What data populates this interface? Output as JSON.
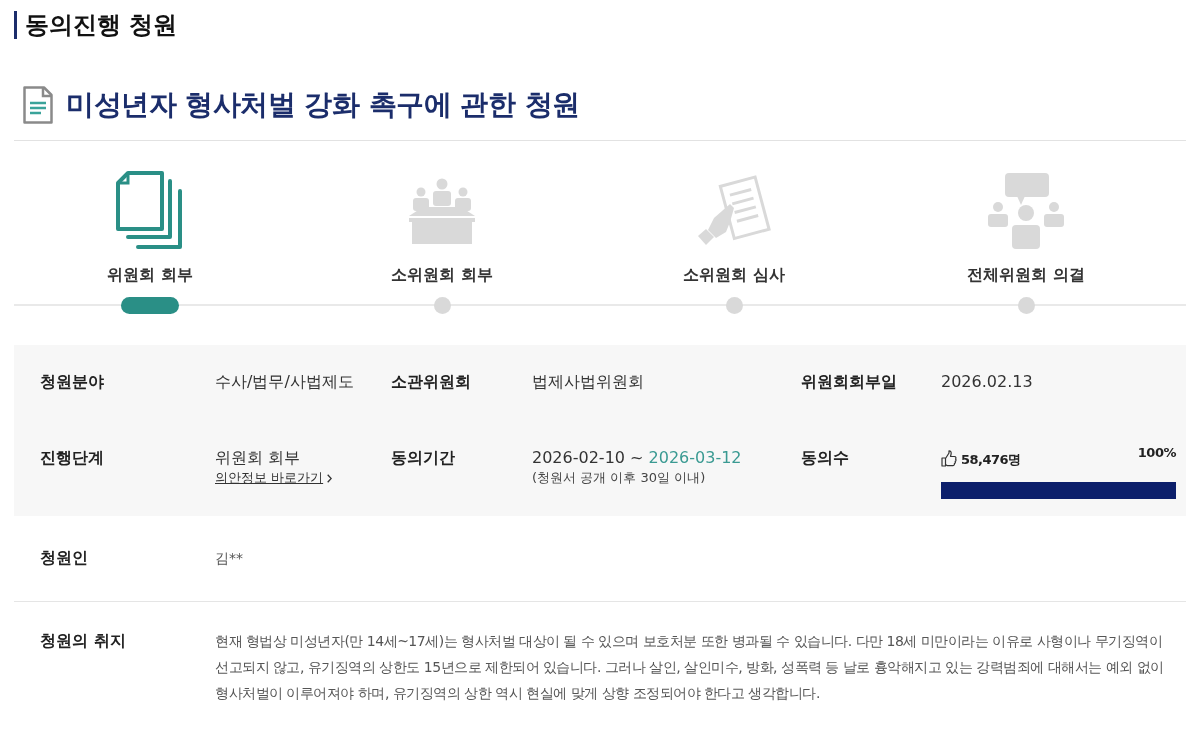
{
  "page": {
    "section_title": "동의진행 청원"
  },
  "petition": {
    "title": "미성년자 형사처벌 강화 촉구에 관한 청원"
  },
  "steps": [
    {
      "label": "위원회 회부",
      "active": true
    },
    {
      "label": "소위원회 회부",
      "active": false
    },
    {
      "label": "소위원회 심사",
      "active": false
    },
    {
      "label": "전체위원회 의결",
      "active": false
    }
  ],
  "info": {
    "rows": [
      [
        {
          "kind": "text",
          "label": "청원분야",
          "value": "수사/법무/사법제도"
        },
        {
          "kind": "text",
          "label": "소관위원회",
          "value": "법제사법위원회"
        },
        {
          "kind": "text",
          "label": "위원회회부일",
          "value": "2026.02.13"
        }
      ],
      [
        {
          "kind": "link",
          "label": "진행단계",
          "value": "위원회 회부",
          "link": "의안정보 바로가기"
        },
        {
          "kind": "period",
          "label": "동의기간",
          "start": "2026-02-10",
          "separator": "~",
          "end": "2026-03-12",
          "note": "(청원서 공개 이후 30일 이내)"
        },
        {
          "kind": "meter",
          "label": "동의수",
          "count": "58,476명",
          "percent": "100%",
          "level": 1
        }
      ]
    ]
  },
  "petitioner": {
    "label": "청원인",
    "value": "김**"
  },
  "purpose": {
    "label": "청원의 취지",
    "text": "현재 형법상 미성년자(만 14세~17세)는 형사처벌 대상이 될 수 있으며 보호처분 또한 병과될 수 있습니다. 다만 18세 미만이라는 이유로 사형이나 무기징역이 선고되지 않고, 유기징역의 상한도 15년으로 제한되어 있습니다. 그러나 살인, 살인미수, 방화, 성폭력 등 날로 흉악해지고 있는 강력범죄에 대해서는 예외 없이 형사처벌이 이루어져야 하며, 유기징역의 상한 역시 현실에 맞게 상향 조정되어야 한다고 생각합니다."
  }
}
